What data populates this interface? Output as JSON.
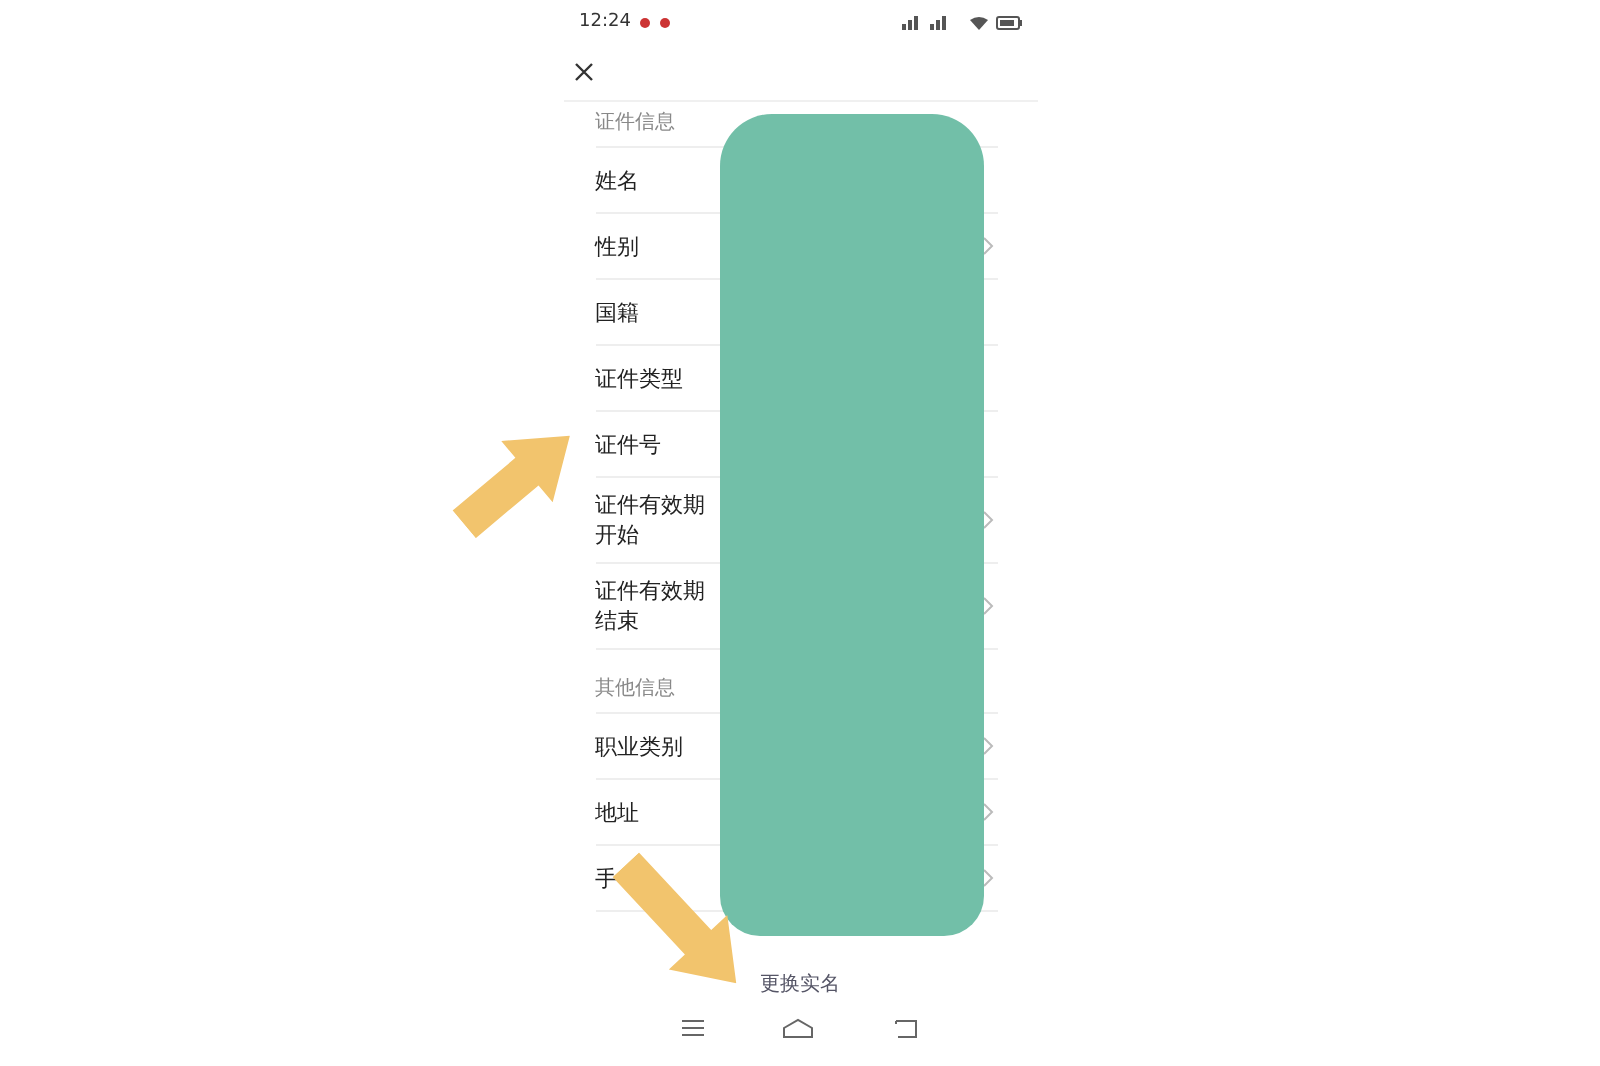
{
  "status_bar": {
    "time": "12:24"
  },
  "sections": [
    {
      "title": "证件信息",
      "rows": [
        {
          "label": "姓名",
          "chevron": false
        },
        {
          "label": "性别",
          "chevron": true
        },
        {
          "label": "国籍",
          "chevron": false
        },
        {
          "label": "证件类型",
          "chevron": false
        },
        {
          "label": "证件号",
          "chevron": false
        },
        {
          "label": "证件有效期开始",
          "chevron": true
        },
        {
          "label": "证件有效期结束",
          "chevron": true
        }
      ]
    },
    {
      "title": "其他信息",
      "rows": [
        {
          "label": "职业类别",
          "chevron": true
        },
        {
          "label": "地址",
          "chevron": true
        },
        {
          "label": "手",
          "chevron": true
        }
      ]
    }
  ],
  "button": "更换实名"
}
